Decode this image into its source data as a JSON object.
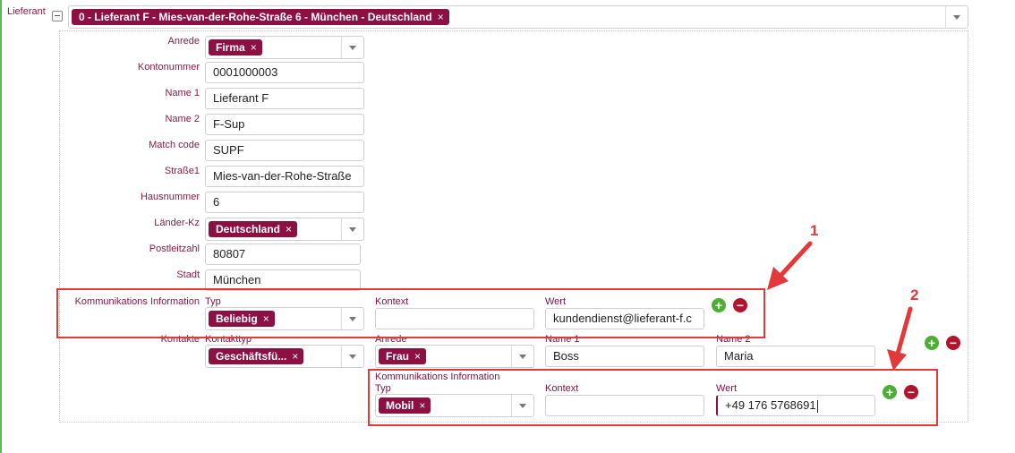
{
  "supplier": {
    "label": "Lieferant",
    "selected": "0 - Lieferant F - Mies-van-der-Rohe-Straße 6 - München - Deutschland"
  },
  "fields": {
    "anrede": {
      "label": "Anrede",
      "value": "Firma"
    },
    "kontonummer": {
      "label": "Kontonummer",
      "value": "0001000003"
    },
    "name1": {
      "label": "Name 1",
      "value": "Lieferant F"
    },
    "name2": {
      "label": "Name 2",
      "value": "F-Sup"
    },
    "matchcode": {
      "label": "Match code",
      "value": "SUPF"
    },
    "strasse": {
      "label": "Straße1",
      "value": "Mies-van-der-Rohe-Straße"
    },
    "hausnummer": {
      "label": "Hausnummer",
      "value": "6"
    },
    "laender": {
      "label": "Länder-Kz",
      "value": "Deutschland"
    },
    "plz": {
      "label": "Postleitzahl",
      "value": "80807"
    },
    "stadt": {
      "label": "Stadt",
      "value": "München"
    }
  },
  "komm1": {
    "section_label": "Kommunikations Information",
    "typ_label": "Typ",
    "typ_value": "Beliebig",
    "kontext_label": "Kontext",
    "kontext_value": "",
    "wert_label": "Wert",
    "wert_value": "kundendienst@lieferant-f.c"
  },
  "kontakte": {
    "section_label": "Kontakte",
    "kontakttyp_label": "Kontakttyp",
    "kontakttyp_value": "Geschäftsfü...",
    "anrede_label": "Anrede",
    "anrede_value": "Frau",
    "name1_label": "Name 1",
    "name1_value": "Boss",
    "name2_label": "Name 2",
    "name2_value": "Maria"
  },
  "komm2": {
    "section_label": "Kommunikations Information",
    "typ_label": "Typ",
    "typ_value": "Mobil",
    "kontext_label": "Kontext",
    "kontext_value": "",
    "wert_label": "Wert",
    "wert_value": "+49 176 5768691"
  },
  "annotations": {
    "one": "1",
    "two": "2"
  },
  "buttons": {
    "plus": "+",
    "minus": "−",
    "remove": "×"
  }
}
